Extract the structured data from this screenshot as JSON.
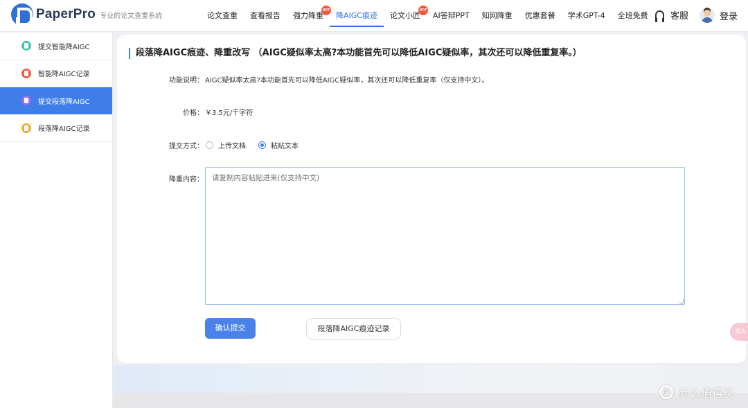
{
  "header": {
    "logo_name": "PaperPro",
    "logo_subtitle": "专业的论文查重系统",
    "nav": [
      {
        "label": "论文查重",
        "hot": false,
        "active": false
      },
      {
        "label": "查看报告",
        "hot": false,
        "active": false
      },
      {
        "label": "强力降重",
        "hot": true,
        "active": false
      },
      {
        "label": "降AIGC痕迹",
        "hot": false,
        "active": true
      },
      {
        "label": "论文小匠",
        "hot": true,
        "active": false
      },
      {
        "label": "AI答辩PPT",
        "hot": false,
        "active": false
      },
      {
        "label": "知网降重",
        "hot": false,
        "active": false
      },
      {
        "label": "优惠套餐",
        "hot": false,
        "active": false
      },
      {
        "label": "学术GPT-4",
        "hot": false,
        "active": false
      },
      {
        "label": "全班免费",
        "hot": false,
        "active": false
      }
    ],
    "hot_badge": "HOT",
    "service_label": "客服",
    "login_label": "登录"
  },
  "sidebar": {
    "items": [
      {
        "label": "提交智能降AIGC",
        "icon": "document-icon",
        "color": "#4cc3b4",
        "active": false
      },
      {
        "label": "智能降AIGC记录",
        "icon": "record-icon",
        "color": "#f0603c",
        "active": false
      },
      {
        "label": "提交段落降AIGC",
        "icon": "paragraph-icon",
        "color": "#9a6cf0",
        "active": true
      },
      {
        "label": "段落降AIGC记录",
        "icon": "record-icon",
        "color": "#f4a940",
        "active": false
      }
    ]
  },
  "main": {
    "title": "段落降AIGC痕迹、降重改写 （AIGC疑似率太高?本功能首先可以降低AIGC疑似率，其次还可以降低重复率。）",
    "description_label": "功能说明：",
    "description_value": "AIGC疑似率太高?本功能首先可以降低AIGC疑似率，其次还可以降低重复率（仅支持中文）。",
    "price_label": "价格：",
    "price_value": "￥3.5元/千字符",
    "submit_method_label": "提交方式：",
    "submit_options": [
      {
        "label": "上传文档",
        "checked": false
      },
      {
        "label": "粘贴文本",
        "checked": true
      }
    ],
    "content_label": "降重内容：",
    "content_placeholder": "请复制内容粘贴进来(仅支持中文)",
    "confirm_button": "确认提交",
    "records_button": "段落降AIGC痕迹记录"
  },
  "floating": {
    "translate_label": "文A"
  },
  "watermark": {
    "icon_text": "值",
    "text": "什么值得买"
  },
  "colors": {
    "accent": "#3f7de8",
    "primary_button": "#4a82ea",
    "hot_badge": "#f05a3c"
  }
}
